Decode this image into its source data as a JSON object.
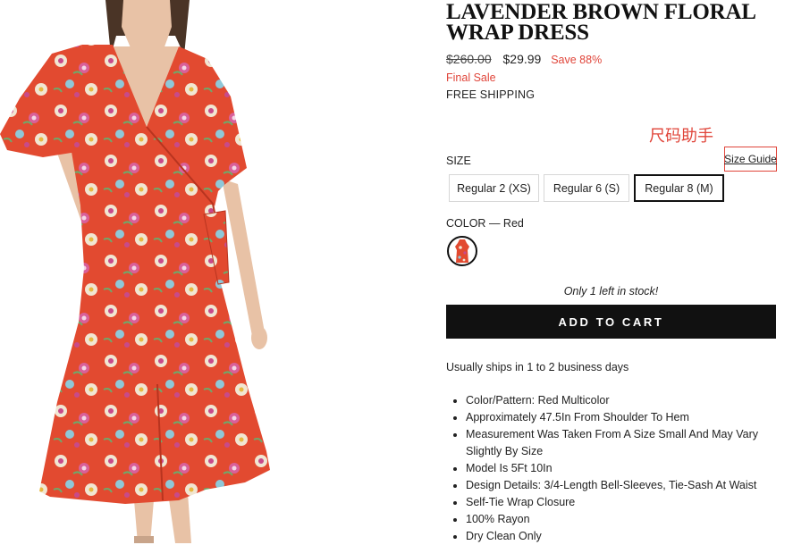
{
  "product": {
    "title": "LAVENDER BROWN FLORAL WRAP DRESS",
    "image_alt_icon": "dress-photo"
  },
  "pricing": {
    "original_price": "$260.00",
    "sale_price": "$29.99",
    "savings": "Save 88%",
    "final_sale": "Final Sale",
    "shipping": "FREE SHIPPING"
  },
  "annotation": {
    "text": "尺码助手",
    "color": "#e0453a"
  },
  "size": {
    "label": "SIZE",
    "guide_label": "Size Guide",
    "options": [
      {
        "label": "Regular 2 (XS)",
        "selected": false
      },
      {
        "label": "Regular 6 (S)",
        "selected": false
      },
      {
        "label": "Regular 8 (M)",
        "selected": true
      }
    ]
  },
  "color": {
    "label": "COLOR",
    "separator": "—",
    "selected": "Red",
    "swatch_color": "#e0453a"
  },
  "stock_message": "Only 1 left in stock!",
  "cart": {
    "button_label": "ADD TO CART"
  },
  "shipping_note": "Usually ships in 1 to 2 business days",
  "features": [
    "Color/Pattern: Red Multicolor",
    "Approximately 47.5In From Shoulder To Hem",
    "Measurement Was Taken From A Size Small And May Vary Slightly By Size",
    "Model Is 5Ft 10In",
    "Design Details: 3/4-Length Bell-Sleeves, Tie-Sash At Waist",
    "Self-Tie Wrap Closure",
    "100% Rayon",
    "Dry Clean Only"
  ],
  "colors": {
    "accent_red": "#e0453a",
    "button_black": "#111111",
    "dress_red": "#e24a30"
  }
}
